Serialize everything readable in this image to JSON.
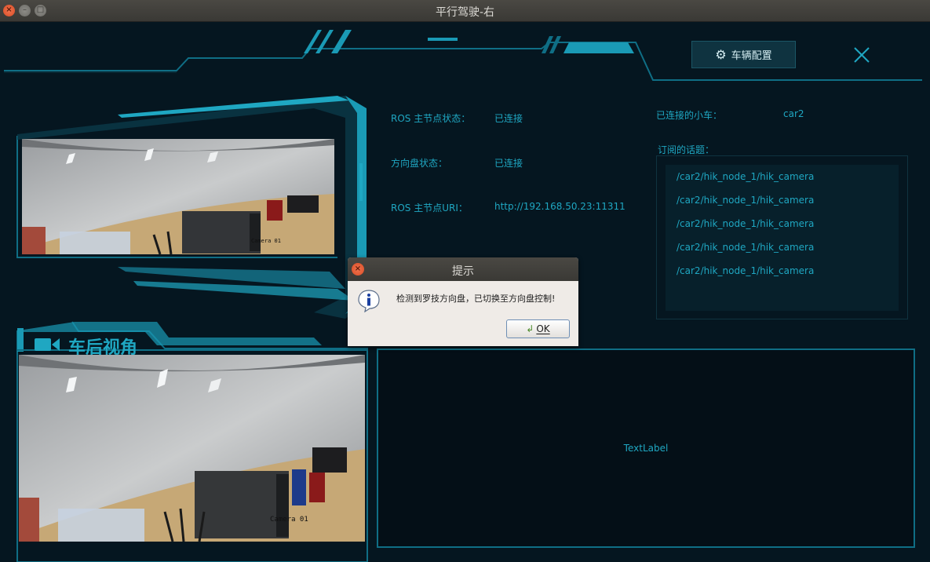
{
  "window": {
    "title": "平行驾驶-右"
  },
  "header": {
    "config_label": "车辆配置"
  },
  "status": {
    "ros_master_label": "ROS 主节点状态：",
    "ros_master_value": "已连接",
    "wheel_label": "方向盘状态：",
    "wheel_value": "已连接",
    "uri_label": "ROS 主节点URI：",
    "uri_value": "http://192.168.50.23:11311",
    "car_label": "已连接的小车：",
    "car_value": "car2",
    "topics_label": "订阅的话题："
  },
  "topics": [
    "/car2/hik_node_1/hik_camera",
    "/car2/hik_node_1/hik_camera",
    "/car2/hik_node_1/hik_camera",
    "/car2/hik_node_1/hik_camera",
    "/car2/hik_node_1/hik_camera"
  ],
  "rear_view": {
    "title": "车后视角",
    "camera_tag": "Camera 01"
  },
  "front_view": {
    "camera_tag": "Camera 01"
  },
  "text_label": "TextLabel",
  "dialog": {
    "title": "提示",
    "message": "检测到罗技方向盘，已切换至方向盘控制!",
    "ok_label": "OK"
  },
  "colors": {
    "accent": "#1fa7c2",
    "background": "#051620",
    "frame": "#0f6e85"
  }
}
